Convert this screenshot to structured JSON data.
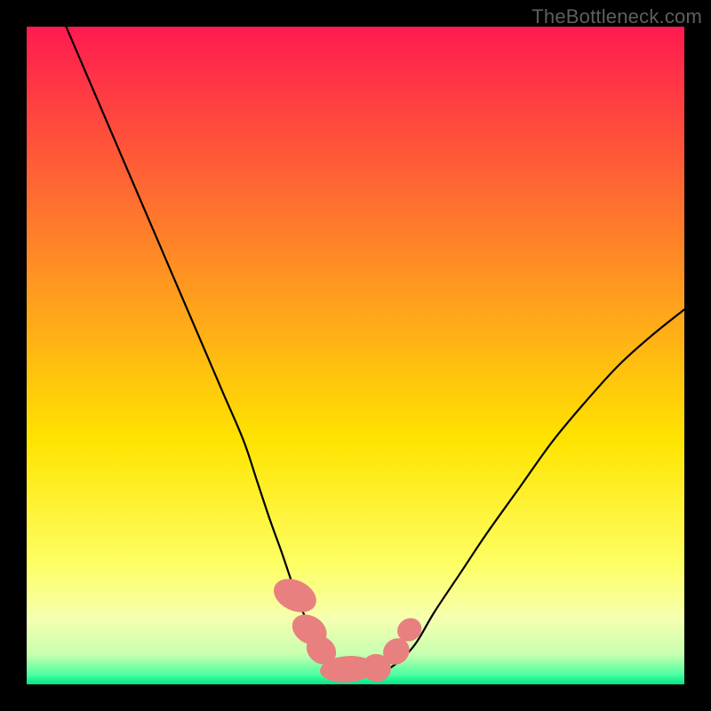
{
  "watermark": "TheBottleneck.com",
  "chart_data": {
    "type": "line",
    "title": "",
    "xlabel": "",
    "ylabel": "",
    "xlim": [
      0,
      100
    ],
    "ylim": [
      0,
      100
    ],
    "grid": false,
    "legend": false,
    "background_gradient_stops": [
      {
        "offset": 0.0,
        "color": "#ff1a50"
      },
      {
        "offset": 0.4,
        "color": "#ff9a1f"
      },
      {
        "offset": 0.63,
        "color": "#ffe400"
      },
      {
        "offset": 0.82,
        "color": "#fdff66"
      },
      {
        "offset": 0.9,
        "color": "#f6ffb0"
      },
      {
        "offset": 0.955,
        "color": "#c7ffb0"
      },
      {
        "offset": 0.985,
        "color": "#4dffa0"
      },
      {
        "offset": 1.0,
        "color": "#00e58a"
      }
    ],
    "series": [
      {
        "name": "bottleneck-curve",
        "stroke": "#000000",
        "stroke_width": 2.2,
        "x": [
          6,
          9,
          12,
          15,
          18,
          21,
          24,
          27,
          30,
          33,
          35,
          37,
          38.8,
          40.5,
          42,
          44,
          46,
          48,
          50,
          51.5,
          53.5,
          56,
          59,
          62,
          66,
          70,
          75,
          80,
          85,
          90,
          95,
          100
        ],
        "y": [
          100,
          93,
          86,
          79,
          72,
          65,
          58,
          51,
          44,
          37,
          31,
          25,
          20,
          15,
          11,
          7,
          4.5,
          2.8,
          1.8,
          1.5,
          1.7,
          3,
          6,
          11,
          17,
          23,
          30,
          37,
          43,
          48.5,
          53,
          57
        ]
      }
    ],
    "markers": {
      "name": "highlight-band",
      "color": "#e88080",
      "points": [
        {
          "x": 40.8,
          "y": 13.5,
          "rx": 2.3,
          "ry": 3.4,
          "rot": -65
        },
        {
          "x": 43.0,
          "y": 8.3,
          "rx": 2.1,
          "ry": 2.8,
          "rot": -58
        },
        {
          "x": 44.8,
          "y": 5.2,
          "rx": 2.0,
          "ry": 2.4,
          "rot": -50
        },
        {
          "x": 48.8,
          "y": 2.3,
          "rx": 4.2,
          "ry": 2.0,
          "rot": -4
        },
        {
          "x": 53.2,
          "y": 2.5,
          "rx": 2.2,
          "ry": 2.1,
          "rot": 20
        },
        {
          "x": 56.2,
          "y": 5.0,
          "rx": 1.9,
          "ry": 2.1,
          "rot": 45
        },
        {
          "x": 58.2,
          "y": 8.3,
          "rx": 1.7,
          "ry": 1.9,
          "rot": 55
        }
      ]
    }
  }
}
